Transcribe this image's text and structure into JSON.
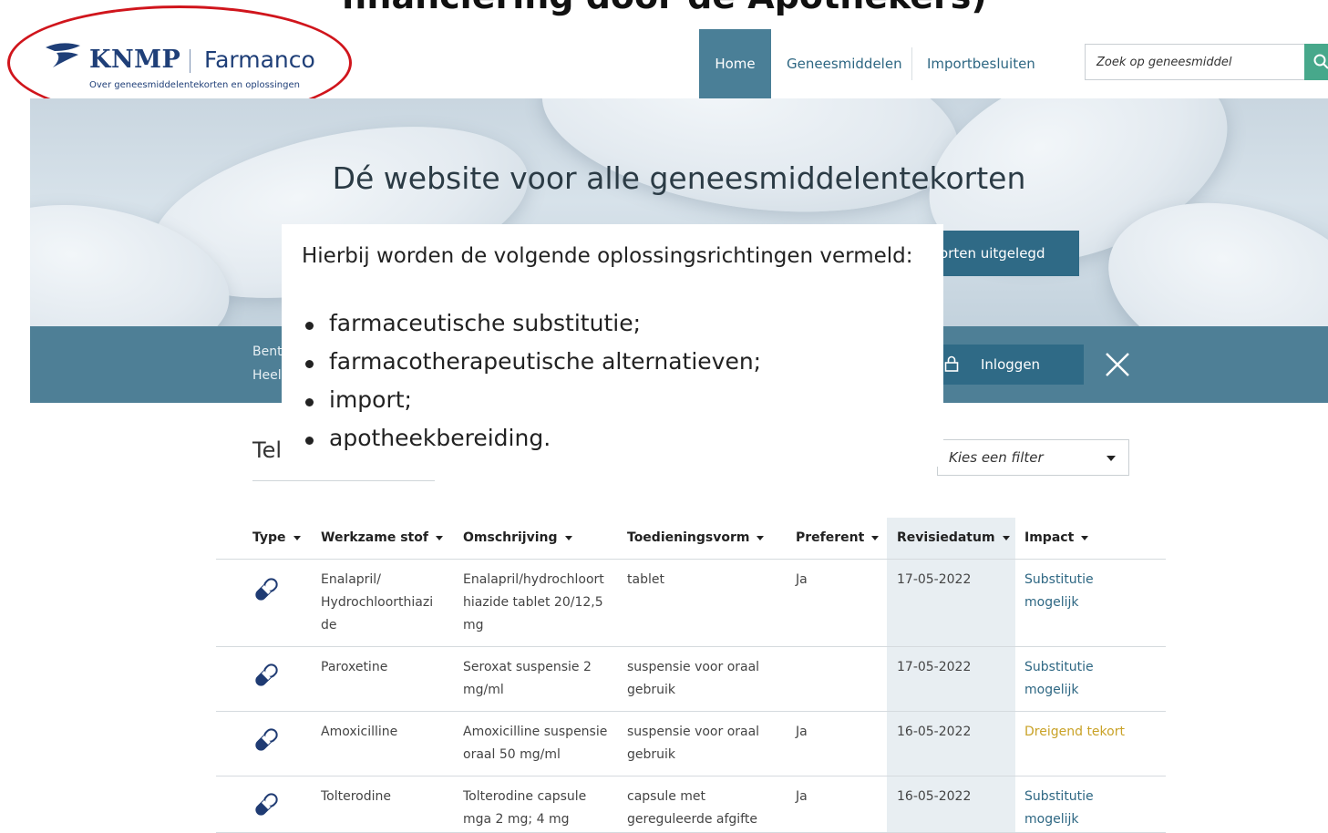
{
  "slide_title": "financiering door de Apothekers)",
  "header": {
    "logo": {
      "knmp": "KNMP",
      "farmanco": "Farmanco",
      "tagline": "Over geneesmiddelentekorten en oplossingen"
    },
    "nav": {
      "home": "Home",
      "geneesmiddelen": "Geneesmiddelen",
      "importbesluiten": "Importbesluiten"
    },
    "search": {
      "placeholder": "Zoek op geneesmiddel",
      "icon": "search-icon"
    }
  },
  "hero": {
    "title": "Dé website voor alle geneesmiddelentekorten",
    "button_label": "orten uitgelegd"
  },
  "bar": {
    "line1": "Bent",
    "line2": "Heel",
    "login_label": "Inloggen",
    "login_icon": "lock-icon",
    "close_icon": "close-icon"
  },
  "overlay": {
    "intro": "Hierbij worden de volgende oplossingsrichtingen vermeld:",
    "items": [
      "farmaceutische substitutie;",
      "farmacotherapeutische alternatieven;",
      "import;",
      "apotheekbereiding."
    ]
  },
  "list": {
    "heading": "Tel",
    "filter_placeholder": "Kies een filter"
  },
  "table": {
    "columns": [
      "Type",
      "Werkzame stof",
      "Omschrijving",
      "Toedieningsvorm",
      "Preferent",
      "Revisiedatum",
      "Impact"
    ],
    "rows": [
      {
        "icon": "capsule-icon",
        "stof": [
          "Enalapril/",
          "Hydrochloorthiazi",
          "de"
        ],
        "omschrijving": [
          "Enalapril/hydrochloort",
          "hiazide tablet 20/12,5",
          "mg"
        ],
        "vorm": [
          "tablet"
        ],
        "preferent": "Ja",
        "datum": "17-05-2022",
        "impact": [
          "Substitutie",
          "mogelijk"
        ]
      },
      {
        "icon": "capsule-icon",
        "stof": [
          "Paroxetine"
        ],
        "omschrijving": [
          "Seroxat suspensie 2",
          "mg/ml"
        ],
        "vorm": [
          "suspensie voor oraal",
          "gebruik"
        ],
        "preferent": "",
        "datum": "17-05-2022",
        "impact": [
          "Substitutie",
          "mogelijk"
        ]
      },
      {
        "icon": "capsule-icon",
        "stof": [
          "Amoxicilline"
        ],
        "omschrijving": [
          "Amoxicilline suspensie",
          "oraal 50 mg/ml"
        ],
        "vorm": [
          "suspensie voor oraal",
          "gebruik"
        ],
        "preferent": "Ja",
        "datum": "16-05-2022",
        "impact": [
          "Dreigend tekort"
        ]
      },
      {
        "icon": "capsule-icon",
        "stof": [
          "Tolterodine"
        ],
        "omschrijving": [
          "Tolterodine capsule",
          "mga 2 mg; 4 mg"
        ],
        "vorm": [
          "capsule met",
          "gereguleerde afgifte"
        ],
        "preferent": "Ja",
        "datum": "16-05-2022",
        "impact": [
          "Substitutie",
          "mogelijk"
        ]
      }
    ]
  },
  "colors": {
    "accent": "#2f6a86",
    "nav_active": "#4a7f97",
    "search_button": "#47a88b",
    "warning": "#c9a227",
    "annotation": "#d0151c"
  }
}
